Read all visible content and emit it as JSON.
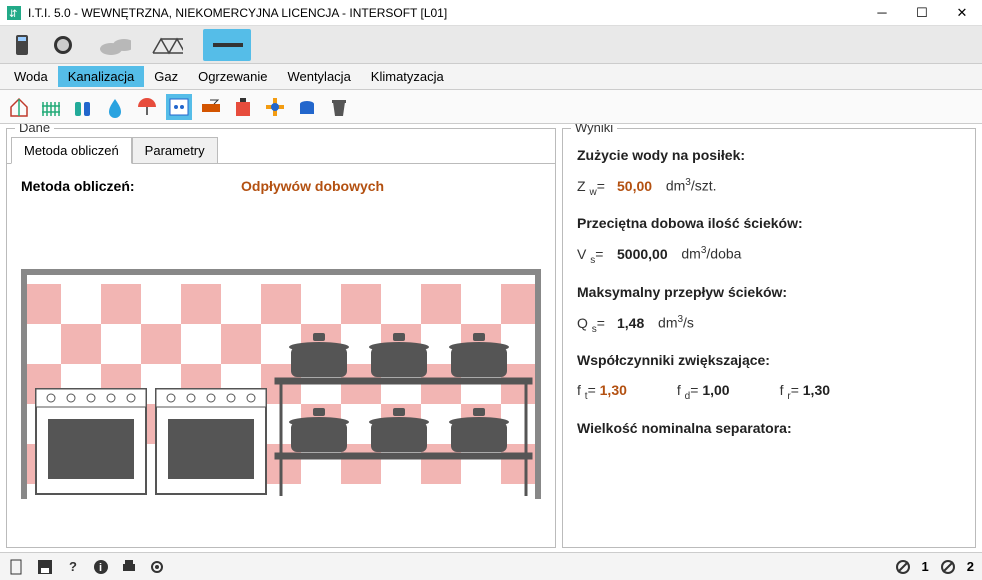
{
  "window": {
    "title": "I.T.I. 5.0 - WEWNĘTRZNA, NIEKOMERCYJNA LICENCJA - INTERSOFT [L01]"
  },
  "menu": {
    "items": [
      "Woda",
      "Kanalizacja",
      "Gaz",
      "Ogrzewanie",
      "Wentylacja",
      "Klimatyzacja"
    ],
    "active_index": 1
  },
  "toolbar_icons": [
    "house-icon",
    "fence-icon",
    "tanks-icon",
    "drop-icon",
    "umbrella-icon",
    "calc-icon",
    "ruler-icon",
    "fuel-icon",
    "pipe-icon",
    "tank-icon",
    "bin-icon"
  ],
  "toolbar_active_index": 5,
  "left": {
    "panel_title": "Dane",
    "tabs": [
      "Metoda obliczeń",
      "Parametry"
    ],
    "active_tab": 0,
    "method_label": "Metoda obliczeń:",
    "method_value": "Odpływów dobowych"
  },
  "right": {
    "panel_title": "Wyniki",
    "h1": "Zużycie wody na posiłek:",
    "r1_sym": "Z w=",
    "r1_val": "50,00",
    "r1_unit": "dm³/szt.",
    "h2": "Przeciętna dobowa ilość ścieków:",
    "r2_sym": "V s=",
    "r2_val": "5000,00",
    "r2_unit": "dm³/doba",
    "h3": "Maksymalny przepływ ścieków:",
    "r3_sym": "Q s=",
    "r3_val": "1,48",
    "r3_unit": "dm³/s",
    "h4": "Współczynniki zwiększające:",
    "c1_sym": "f t=",
    "c1_val": "1,30",
    "c2_sym": "f d=",
    "c2_val": "1,00",
    "c3_sym": "f r=",
    "c3_val": "1,30",
    "h5": "Wielkość nominalna separatora:"
  },
  "status": {
    "right1": "1",
    "right2": "2"
  }
}
